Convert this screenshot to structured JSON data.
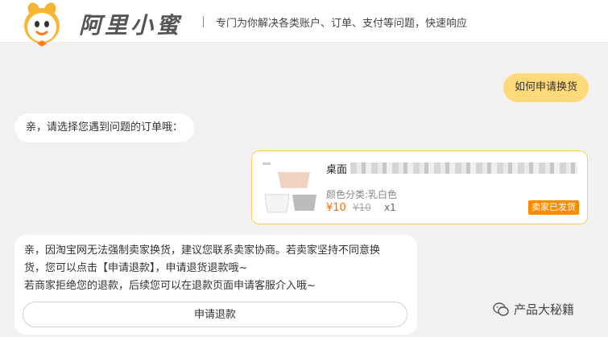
{
  "header": {
    "brand": "阿里小蜜",
    "tagline": "专门为你解决各类账户、订单、支付等问题，快速响应"
  },
  "messages": {
    "user_question": "如何申请换货",
    "bot_prompt": "亲，请选择您遇到问题的订单哦：",
    "bot_reply_line1": "亲，因淘宝网无法强制卖家换货，建议您联系卖家协商。若卖家坚持不同意换",
    "bot_reply_line2": "货，您可以点击【申请退款】，申请退货退款哦~",
    "bot_reply_line3": "若商家拒绝您的退款，后续您可以在退款页面申请客服介入哦~",
    "refund_button": "申请退款"
  },
  "order": {
    "title_prefix": "桌面",
    "spec": "颜色分类:乳白色",
    "price": "¥10",
    "original_price": "¥10",
    "quantity": "x1",
    "status": "卖家已发货"
  },
  "watermark": {
    "text": "产品大秘籍",
    "icon": "wechat-icon"
  },
  "colors": {
    "user_bubble": "#ffd97a",
    "card_border": "#ffcf5a",
    "price": "#ff6a00",
    "status_badge": "#ff8c00"
  }
}
